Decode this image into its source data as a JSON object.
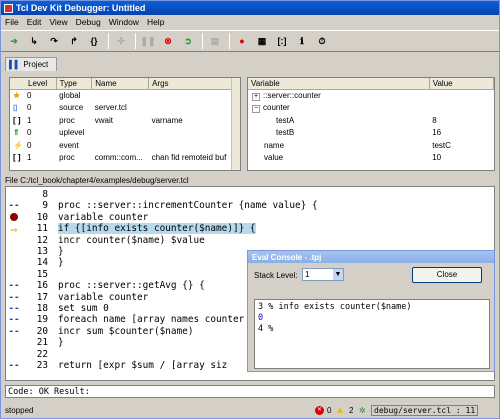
{
  "window": {
    "title": "Tcl Dev Kit Debugger: Untitled"
  },
  "menu": [
    "File",
    "Edit",
    "View",
    "Debug",
    "Window",
    "Help"
  ],
  "toolbar": {
    "icons": [
      "run-icon",
      "step-in-icon",
      "step-over-icon",
      "step-out-icon",
      "step-to-result-icon",
      "stop-icon",
      "pause-icon",
      "kill-icon",
      "restart-icon",
      "break-icon",
      "breakpoint-icon",
      "watch-icon",
      "eval-console-icon",
      "procedures-icon",
      "timer-icon"
    ]
  },
  "project_tab": "Project",
  "stack": {
    "columns": [
      "Level",
      "Type",
      "Name",
      "Args"
    ],
    "rows": [
      {
        "level": "0",
        "type": "global",
        "name": "",
        "args": ""
      },
      {
        "level": "0",
        "type": "source",
        "name": "server.tcl",
        "args": ""
      },
      {
        "level": "1",
        "type": "proc",
        "name": "vwait",
        "args": "varname"
      },
      {
        "level": "0",
        "type": "uplevel",
        "name": "",
        "args": ""
      },
      {
        "level": "0",
        "type": "event",
        "name": "",
        "args": ""
      },
      {
        "level": "1",
        "type": "proc",
        "name": "comm::com...",
        "args": "chan fid remoteid buf"
      }
    ]
  },
  "vars": {
    "columns": [
      "Variable",
      "Value"
    ],
    "rows": [
      {
        "name": "::server::counter",
        "value": "",
        "indent": 0,
        "toggle": "+"
      },
      {
        "name": "counter",
        "value": "",
        "indent": 0,
        "toggle": "−"
      },
      {
        "name": "testA",
        "value": "8",
        "indent": 2,
        "toggle": ""
      },
      {
        "name": "testB",
        "value": "16",
        "indent": 2,
        "toggle": ""
      },
      {
        "name": "name",
        "value": "testC",
        "indent": 1,
        "toggle": ""
      },
      {
        "name": "value",
        "value": "10",
        "indent": 1,
        "toggle": ""
      }
    ]
  },
  "file": {
    "label": "File C:/tcl_book/chapter4/examples/debug/server.tcl"
  },
  "code": [
    {
      "n": "8",
      "t": "",
      "m": ""
    },
    {
      "n": "9",
      "t": "proc ::server::incrementCounter {name value} {",
      "m": "--"
    },
    {
      "n": "10",
      "t": "    variable counter",
      "m": "bp"
    },
    {
      "n": "11",
      "t": "    if {[info exists counter($name)]} {",
      "m": "arrow"
    },
    {
      "n": "12",
      "t": "        incr counter($name) $value",
      "m": ""
    },
    {
      "n": "13",
      "t": "    }",
      "m": ""
    },
    {
      "n": "14",
      "t": "}",
      "m": ""
    },
    {
      "n": "15",
      "t": "",
      "m": ""
    },
    {
      "n": "16",
      "t": "proc ::server::getAvg {} {",
      "m": "--"
    },
    {
      "n": "17",
      "t": "    variable counter",
      "m": "--"
    },
    {
      "n": "18",
      "t": "    set sum 0",
      "m": "--"
    },
    {
      "n": "19",
      "t": "    foreach name [array names counter",
      "m": "--"
    },
    {
      "n": "20",
      "t": "        incr sum $counter($name)",
      "m": "--"
    },
    {
      "n": "21",
      "t": "    }",
      "m": ""
    },
    {
      "n": "22",
      "t": "",
      "m": ""
    },
    {
      "n": "23",
      "t": "    return [expr $sum / [array siz",
      "m": "--"
    }
  ],
  "console": {
    "title": "Eval Console - .tpj",
    "stack_label": "Stack Level:",
    "stack_value": "1",
    "close_label": "Close",
    "lines": [
      "3 % info exists counter($name)",
      "0",
      "4 %"
    ]
  },
  "result": "Code: OK Result:",
  "status": {
    "text": "stopped",
    "errors": "0",
    "warnings": "2",
    "location": "debug/server.tcl : 11"
  }
}
